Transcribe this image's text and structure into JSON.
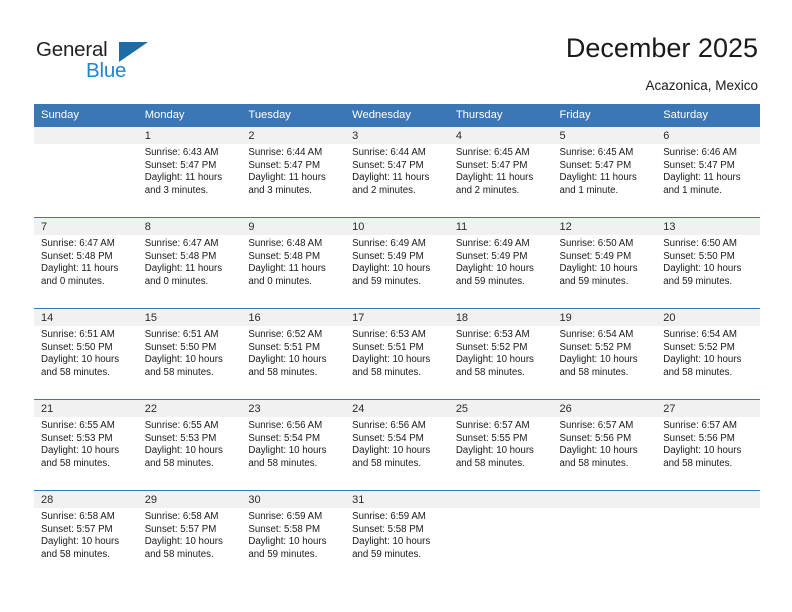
{
  "brand": {
    "name_part1": "General",
    "name_part2": "Blue",
    "triangle_color": "#1b6ca8",
    "blue_color": "#1f86d0",
    "dark_color": "#231f20"
  },
  "header": {
    "title": "December 2025",
    "location": "Acazonica, Mexico"
  },
  "colors": {
    "header_band": "#3b77b4",
    "daynum_band": "#f1f1f1",
    "cell_background": "#ffffff",
    "text": "#1a1a1a"
  },
  "weekday_headers": [
    "Sunday",
    "Monday",
    "Tuesday",
    "Wednesday",
    "Thursday",
    "Friday",
    "Saturday"
  ],
  "weeks": [
    [
      {
        "day": "",
        "sunrise": "",
        "sunset": "",
        "daylight": "",
        "empty": true
      },
      {
        "day": "1",
        "sunrise": "Sunrise: 6:43 AM",
        "sunset": "Sunset: 5:47 PM",
        "daylight_line1": "Daylight: 11 hours",
        "daylight_line2": "and 3 minutes."
      },
      {
        "day": "2",
        "sunrise": "Sunrise: 6:44 AM",
        "sunset": "Sunset: 5:47 PM",
        "daylight_line1": "Daylight: 11 hours",
        "daylight_line2": "and 3 minutes."
      },
      {
        "day": "3",
        "sunrise": "Sunrise: 6:44 AM",
        "sunset": "Sunset: 5:47 PM",
        "daylight_line1": "Daylight: 11 hours",
        "daylight_line2": "and 2 minutes."
      },
      {
        "day": "4",
        "sunrise": "Sunrise: 6:45 AM",
        "sunset": "Sunset: 5:47 PM",
        "daylight_line1": "Daylight: 11 hours",
        "daylight_line2": "and 2 minutes."
      },
      {
        "day": "5",
        "sunrise": "Sunrise: 6:45 AM",
        "sunset": "Sunset: 5:47 PM",
        "daylight_line1": "Daylight: 11 hours",
        "daylight_line2": "and 1 minute."
      },
      {
        "day": "6",
        "sunrise": "Sunrise: 6:46 AM",
        "sunset": "Sunset: 5:47 PM",
        "daylight_line1": "Daylight: 11 hours",
        "daylight_line2": "and 1 minute."
      }
    ],
    [
      {
        "day": "7",
        "sunrise": "Sunrise: 6:47 AM",
        "sunset": "Sunset: 5:48 PM",
        "daylight_line1": "Daylight: 11 hours",
        "daylight_line2": "and 0 minutes."
      },
      {
        "day": "8",
        "sunrise": "Sunrise: 6:47 AM",
        "sunset": "Sunset: 5:48 PM",
        "daylight_line1": "Daylight: 11 hours",
        "daylight_line2": "and 0 minutes."
      },
      {
        "day": "9",
        "sunrise": "Sunrise: 6:48 AM",
        "sunset": "Sunset: 5:48 PM",
        "daylight_line1": "Daylight: 11 hours",
        "daylight_line2": "and 0 minutes."
      },
      {
        "day": "10",
        "sunrise": "Sunrise: 6:49 AM",
        "sunset": "Sunset: 5:49 PM",
        "daylight_line1": "Daylight: 10 hours",
        "daylight_line2": "and 59 minutes."
      },
      {
        "day": "11",
        "sunrise": "Sunrise: 6:49 AM",
        "sunset": "Sunset: 5:49 PM",
        "daylight_line1": "Daylight: 10 hours",
        "daylight_line2": "and 59 minutes."
      },
      {
        "day": "12",
        "sunrise": "Sunrise: 6:50 AM",
        "sunset": "Sunset: 5:49 PM",
        "daylight_line1": "Daylight: 10 hours",
        "daylight_line2": "and 59 minutes."
      },
      {
        "day": "13",
        "sunrise": "Sunrise: 6:50 AM",
        "sunset": "Sunset: 5:50 PM",
        "daylight_line1": "Daylight: 10 hours",
        "daylight_line2": "and 59 minutes."
      }
    ],
    [
      {
        "day": "14",
        "sunrise": "Sunrise: 6:51 AM",
        "sunset": "Sunset: 5:50 PM",
        "daylight_line1": "Daylight: 10 hours",
        "daylight_line2": "and 58 minutes."
      },
      {
        "day": "15",
        "sunrise": "Sunrise: 6:51 AM",
        "sunset": "Sunset: 5:50 PM",
        "daylight_line1": "Daylight: 10 hours",
        "daylight_line2": "and 58 minutes."
      },
      {
        "day": "16",
        "sunrise": "Sunrise: 6:52 AM",
        "sunset": "Sunset: 5:51 PM",
        "daylight_line1": "Daylight: 10 hours",
        "daylight_line2": "and 58 minutes."
      },
      {
        "day": "17",
        "sunrise": "Sunrise: 6:53 AM",
        "sunset": "Sunset: 5:51 PM",
        "daylight_line1": "Daylight: 10 hours",
        "daylight_line2": "and 58 minutes."
      },
      {
        "day": "18",
        "sunrise": "Sunrise: 6:53 AM",
        "sunset": "Sunset: 5:52 PM",
        "daylight_line1": "Daylight: 10 hours",
        "daylight_line2": "and 58 minutes."
      },
      {
        "day": "19",
        "sunrise": "Sunrise: 6:54 AM",
        "sunset": "Sunset: 5:52 PM",
        "daylight_line1": "Daylight: 10 hours",
        "daylight_line2": "and 58 minutes."
      },
      {
        "day": "20",
        "sunrise": "Sunrise: 6:54 AM",
        "sunset": "Sunset: 5:52 PM",
        "daylight_line1": "Daylight: 10 hours",
        "daylight_line2": "and 58 minutes."
      }
    ],
    [
      {
        "day": "21",
        "sunrise": "Sunrise: 6:55 AM",
        "sunset": "Sunset: 5:53 PM",
        "daylight_line1": "Daylight: 10 hours",
        "daylight_line2": "and 58 minutes."
      },
      {
        "day": "22",
        "sunrise": "Sunrise: 6:55 AM",
        "sunset": "Sunset: 5:53 PM",
        "daylight_line1": "Daylight: 10 hours",
        "daylight_line2": "and 58 minutes."
      },
      {
        "day": "23",
        "sunrise": "Sunrise: 6:56 AM",
        "sunset": "Sunset: 5:54 PM",
        "daylight_line1": "Daylight: 10 hours",
        "daylight_line2": "and 58 minutes."
      },
      {
        "day": "24",
        "sunrise": "Sunrise: 6:56 AM",
        "sunset": "Sunset: 5:54 PM",
        "daylight_line1": "Daylight: 10 hours",
        "daylight_line2": "and 58 minutes."
      },
      {
        "day": "25",
        "sunrise": "Sunrise: 6:57 AM",
        "sunset": "Sunset: 5:55 PM",
        "daylight_line1": "Daylight: 10 hours",
        "daylight_line2": "and 58 minutes."
      },
      {
        "day": "26",
        "sunrise": "Sunrise: 6:57 AM",
        "sunset": "Sunset: 5:56 PM",
        "daylight_line1": "Daylight: 10 hours",
        "daylight_line2": "and 58 minutes."
      },
      {
        "day": "27",
        "sunrise": "Sunrise: 6:57 AM",
        "sunset": "Sunset: 5:56 PM",
        "daylight_line1": "Daylight: 10 hours",
        "daylight_line2": "and 58 minutes."
      }
    ],
    [
      {
        "day": "28",
        "sunrise": "Sunrise: 6:58 AM",
        "sunset": "Sunset: 5:57 PM",
        "daylight_line1": "Daylight: 10 hours",
        "daylight_line2": "and 58 minutes."
      },
      {
        "day": "29",
        "sunrise": "Sunrise: 6:58 AM",
        "sunset": "Sunset: 5:57 PM",
        "daylight_line1": "Daylight: 10 hours",
        "daylight_line2": "and 58 minutes."
      },
      {
        "day": "30",
        "sunrise": "Sunrise: 6:59 AM",
        "sunset": "Sunset: 5:58 PM",
        "daylight_line1": "Daylight: 10 hours",
        "daylight_line2": "and 59 minutes."
      },
      {
        "day": "31",
        "sunrise": "Sunrise: 6:59 AM",
        "sunset": "Sunset: 5:58 PM",
        "daylight_line1": "Daylight: 10 hours",
        "daylight_line2": "and 59 minutes."
      },
      {
        "day": "",
        "sunrise": "",
        "sunset": "",
        "daylight": "",
        "empty": true
      },
      {
        "day": "",
        "sunrise": "",
        "sunset": "",
        "daylight": "",
        "empty": true
      },
      {
        "day": "",
        "sunrise": "",
        "sunset": "",
        "daylight": "",
        "empty": true
      }
    ]
  ]
}
